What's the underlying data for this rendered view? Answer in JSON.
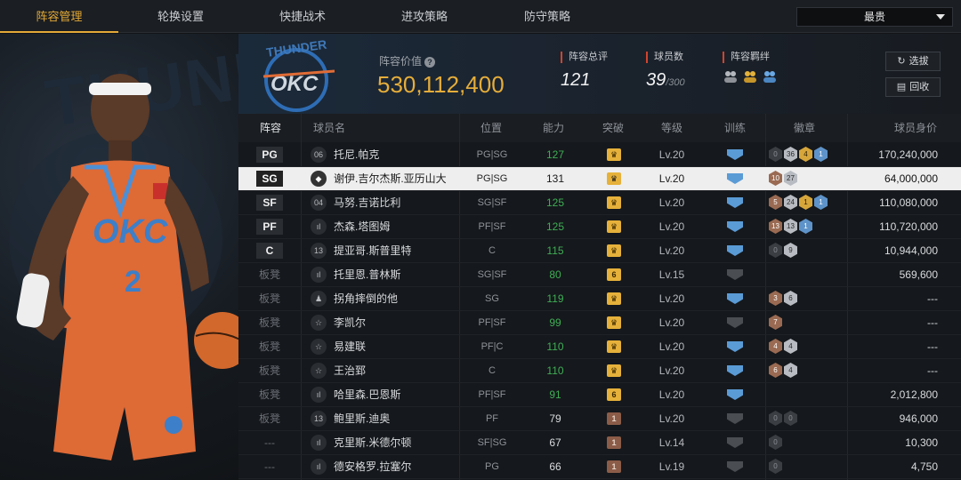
{
  "tabs": [
    {
      "label": "阵容管理",
      "active": true
    },
    {
      "label": "轮换设置",
      "active": false
    },
    {
      "label": "快捷战术",
      "active": false
    },
    {
      "label": "进攻策略",
      "active": false
    },
    {
      "label": "防守策略",
      "active": false
    }
  ],
  "sort": {
    "selected": "最贵"
  },
  "team": {
    "value_label": "阵容价值",
    "value": "530,112,400",
    "rating_label": "阵容总评",
    "rating": "121",
    "players_label": "球员数",
    "players": "39",
    "players_max": "/300",
    "bond_label": "阵容羁绊"
  },
  "buttons": {
    "draft": "选拔",
    "recycle": "回收"
  },
  "headers": {
    "pos": "阵容",
    "name": "球员名",
    "position": "位置",
    "ability": "能力",
    "breakthrough": "突破",
    "level": "等级",
    "training": "训练",
    "badges": "徽章",
    "salary": "球员身价"
  },
  "rows": [
    {
      "pos": "PG",
      "type": "06",
      "name": "托尼.帕克",
      "position": "PG|SG",
      "ability": "127",
      "green": true,
      "brk": "crown",
      "level": "Lv.20",
      "train": "blue",
      "badges": [
        [
          "b0",
          "0"
        ],
        [
          "sl",
          "36"
        ],
        [
          "gd",
          "4"
        ],
        [
          "hf",
          "1"
        ]
      ],
      "salary": "170,240,000"
    },
    {
      "pos": "SG",
      "type": "◆",
      "name": "谢伊.吉尔杰斯.亚历山大",
      "position": "PG|SG",
      "ability": "131",
      "green": false,
      "brk": "crown",
      "level": "Lv.20",
      "train": "blue",
      "badges": [
        [
          "br",
          "10"
        ],
        [
          "sl",
          "27"
        ]
      ],
      "salary": "64,000,000",
      "selected": true
    },
    {
      "pos": "SF",
      "type": "04",
      "name": "马努.吉诺比利",
      "position": "SG|SF",
      "ability": "125",
      "green": true,
      "brk": "crown",
      "level": "Lv.20",
      "train": "blue",
      "badges": [
        [
          "br",
          "5"
        ],
        [
          "sl",
          "24"
        ],
        [
          "gd",
          "1"
        ],
        [
          "hf",
          "1"
        ]
      ],
      "salary": "110,080,000"
    },
    {
      "pos": "PF",
      "type": "ıl",
      "name": "杰森.塔图姆",
      "position": "PF|SF",
      "ability": "125",
      "green": true,
      "brk": "crown",
      "level": "Lv.20",
      "train": "blue",
      "badges": [
        [
          "br",
          "13"
        ],
        [
          "sl",
          "13"
        ],
        [
          "hf",
          "1"
        ]
      ],
      "salary": "110,720,000"
    },
    {
      "pos": "C",
      "type": "13",
      "name": "提亚哥.斯普里特",
      "position": "C",
      "ability": "115",
      "green": true,
      "brk": "crown",
      "level": "Lv.20",
      "train": "blue",
      "badges": [
        [
          "b0",
          "0"
        ],
        [
          "sl",
          "9"
        ]
      ],
      "salary": "10,944,000"
    },
    {
      "pos": "板凳",
      "type": "ıl",
      "name": "托里恩.普林斯",
      "position": "SG|SF",
      "ability": "80",
      "green": true,
      "brk": "six",
      "level": "Lv.15",
      "train": "grey",
      "badges": [],
      "salary": "569,600"
    },
    {
      "pos": "板凳",
      "type": "♟",
      "name": "拐角摔倒的他",
      "position": "SG",
      "ability": "119",
      "green": true,
      "brk": "crown",
      "level": "Lv.20",
      "train": "blue",
      "badges": [
        [
          "br",
          "3"
        ],
        [
          "sl",
          "6"
        ]
      ],
      "salary": "---"
    },
    {
      "pos": "板凳",
      "type": "☆",
      "name": "李凯尔",
      "position": "PF|SF",
      "ability": "99",
      "green": true,
      "brk": "crown",
      "level": "Lv.20",
      "train": "grey",
      "badges": [
        [
          "br",
          "7"
        ]
      ],
      "salary": "---"
    },
    {
      "pos": "板凳",
      "type": "☆",
      "name": "易建联",
      "position": "PF|C",
      "ability": "110",
      "green": true,
      "brk": "crown",
      "level": "Lv.20",
      "train": "blue",
      "badges": [
        [
          "br",
          "4"
        ],
        [
          "sl",
          "4"
        ]
      ],
      "salary": "---"
    },
    {
      "pos": "板凳",
      "type": "☆",
      "name": "王治郅",
      "position": "C",
      "ability": "110",
      "green": true,
      "brk": "crown",
      "level": "Lv.20",
      "train": "blue",
      "badges": [
        [
          "br",
          "6"
        ],
        [
          "sl",
          "4"
        ]
      ],
      "salary": "---"
    },
    {
      "pos": "板凳",
      "type": "ıl",
      "name": "哈里森.巴恩斯",
      "position": "PF|SF",
      "ability": "91",
      "green": true,
      "brk": "six",
      "level": "Lv.20",
      "train": "blue",
      "badges": [],
      "salary": "2,012,800"
    },
    {
      "pos": "板凳",
      "type": "13",
      "name": "鲍里斯.迪奥",
      "position": "PF",
      "ability": "79",
      "green": false,
      "brk": "one",
      "level": "Lv.20",
      "train": "grey",
      "badges": [
        [
          "b0",
          "0"
        ],
        [
          "b0",
          "0"
        ]
      ],
      "salary": "946,000"
    },
    {
      "pos": "---",
      "type": "ıl",
      "name": "克里斯.米德尔顿",
      "position": "SF|SG",
      "ability": "67",
      "green": false,
      "brk": "one",
      "level": "Lv.14",
      "train": "grey",
      "badges": [
        [
          "b0",
          "0"
        ]
      ],
      "salary": "10,300"
    },
    {
      "pos": "---",
      "type": "ıl",
      "name": "德安格罗.拉塞尔",
      "position": "PG",
      "ability": "66",
      "green": false,
      "brk": "one",
      "level": "Lv.19",
      "train": "grey",
      "badges": [
        [
          "b0",
          "0"
        ]
      ],
      "salary": "4,750"
    }
  ],
  "brk_labels": {
    "crown": "♛",
    "six": "6",
    "one": "1"
  }
}
